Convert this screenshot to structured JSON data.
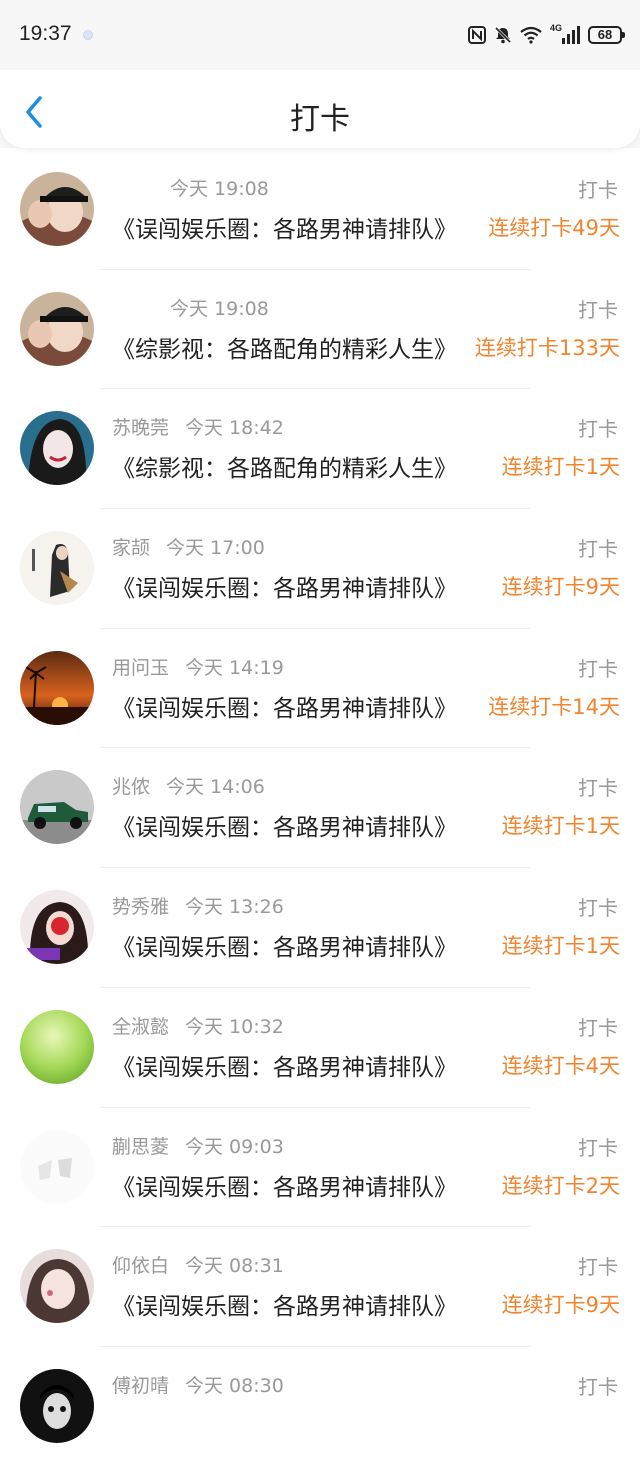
{
  "status_bar": {
    "time": "19:37",
    "battery": "68",
    "network": "4G"
  },
  "header": {
    "title": "打卡"
  },
  "records": [
    {
      "name": "",
      "time": "今天 19:08",
      "action": "打卡",
      "book": "《误闯娱乐圈：各路男神请排队》",
      "streak": "连续打卡49天",
      "avatar": "avatar-girl-cap"
    },
    {
      "name": "",
      "time": "今天 19:08",
      "action": "打卡",
      "book": "《综影视：各路配角的精彩人生》",
      "streak": "连续打卡133天",
      "avatar": "avatar-girl-cap"
    },
    {
      "name": "苏晚莞",
      "time": "今天 18:42",
      "action": "打卡",
      "book": "《综影视：各路配角的精彩人生》",
      "streak": "连续打卡1天",
      "avatar": "avatar-woman-dark-hair"
    },
    {
      "name": "家颉",
      "time": "今天 17:00",
      "action": "打卡",
      "book": "《误闯娱乐圈：各路男神请排队》",
      "streak": "连续打卡9天",
      "avatar": "avatar-ink-warrior"
    },
    {
      "name": "用问玉",
      "time": "今天 14:19",
      "action": "打卡",
      "book": "《误闯娱乐圈：各路男神请排队》",
      "streak": "连续打卡14天",
      "avatar": "avatar-sunset"
    },
    {
      "name": "兆侬",
      "time": "今天 14:06",
      "action": "打卡",
      "book": "《误闯娱乐圈：各路男神请排队》",
      "streak": "连续打卡1天",
      "avatar": "avatar-vintage-car"
    },
    {
      "name": "势秀雅",
      "time": "今天 13:26",
      "action": "打卡",
      "book": "《误闯娱乐圈：各路男神请排队》",
      "streak": "连续打卡1天",
      "avatar": "avatar-girl-red"
    },
    {
      "name": "全淑懿",
      "time": "今天 10:32",
      "action": "打卡",
      "book": "《误闯娱乐圈：各路男神请排队》",
      "streak": "连续打卡4天",
      "avatar": "avatar-green-orb"
    },
    {
      "name": "蒯思菱",
      "time": "今天 09:03",
      "action": "打卡",
      "book": "《误闯娱乐圈：各路男神请排队》",
      "streak": "连续打卡2天",
      "avatar": "avatar-white-sketch"
    },
    {
      "name": "仰依白",
      "time": "今天 08:31",
      "action": "打卡",
      "book": "《误闯娱乐圈：各路男神请排队》",
      "streak": "连续打卡9天",
      "avatar": "avatar-girl-face"
    },
    {
      "name": "傅初晴",
      "time": "今天 08:30",
      "action": "打卡",
      "book": "",
      "streak": "",
      "avatar": "avatar-dark-portrait"
    }
  ],
  "colors": {
    "accent": "#f0842f",
    "back": "#1a8fe3",
    "muted": "#999999"
  }
}
